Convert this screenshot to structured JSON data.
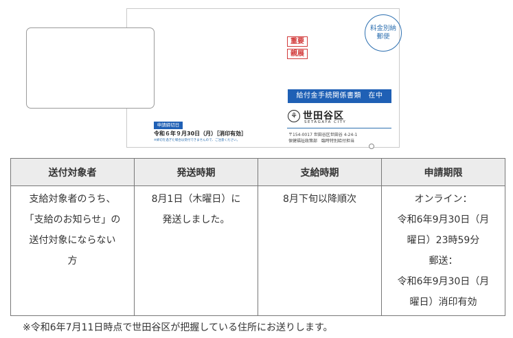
{
  "envelope": {
    "stamp_line1": "料金別納",
    "stamp_line2": "郵便",
    "tag_important": "重要",
    "tag_personal": "親展",
    "doc_bar": "給付金手続関係書類　在中",
    "logo_glyph": "⚘",
    "city_name": "世田谷区",
    "city_name_en": "SETAGAYA CITY",
    "address_line1": "〒154-0017 世田谷区世田谷 4-24-1",
    "address_line2": "保健福祉政策部　臨時特別給付担当",
    "deadline_label": "申請締切日",
    "deadline_date": "令和６年９月30日（月）［消印有効］",
    "deadline_note": "※締切を過ぎた場合は受付できませんので、ご注意ください。"
  },
  "table": {
    "headers": [
      "送付対象者",
      "発送時期",
      "支給時期",
      "申請期限"
    ],
    "rows": [
      [
        "支給対象者のうち、\n「支給のお知らせ」の\n送付対象にならない\n方",
        "8月1日（木曜日）に\n発送しました。",
        "8月下旬以降順次",
        "オンライン：\n令和6年9月30日（月\n曜日）23時59分\n郵送：\n令和6年9月30日（月\n曜日）消印有効"
      ]
    ]
  },
  "footnote": "※令和6年7月11日時点で世田谷区が把握している住所にお送りします。",
  "colors": {
    "accent_blue": "#1f60b5",
    "tag_red": "#d23a3a",
    "header_bg": "#ececec"
  }
}
